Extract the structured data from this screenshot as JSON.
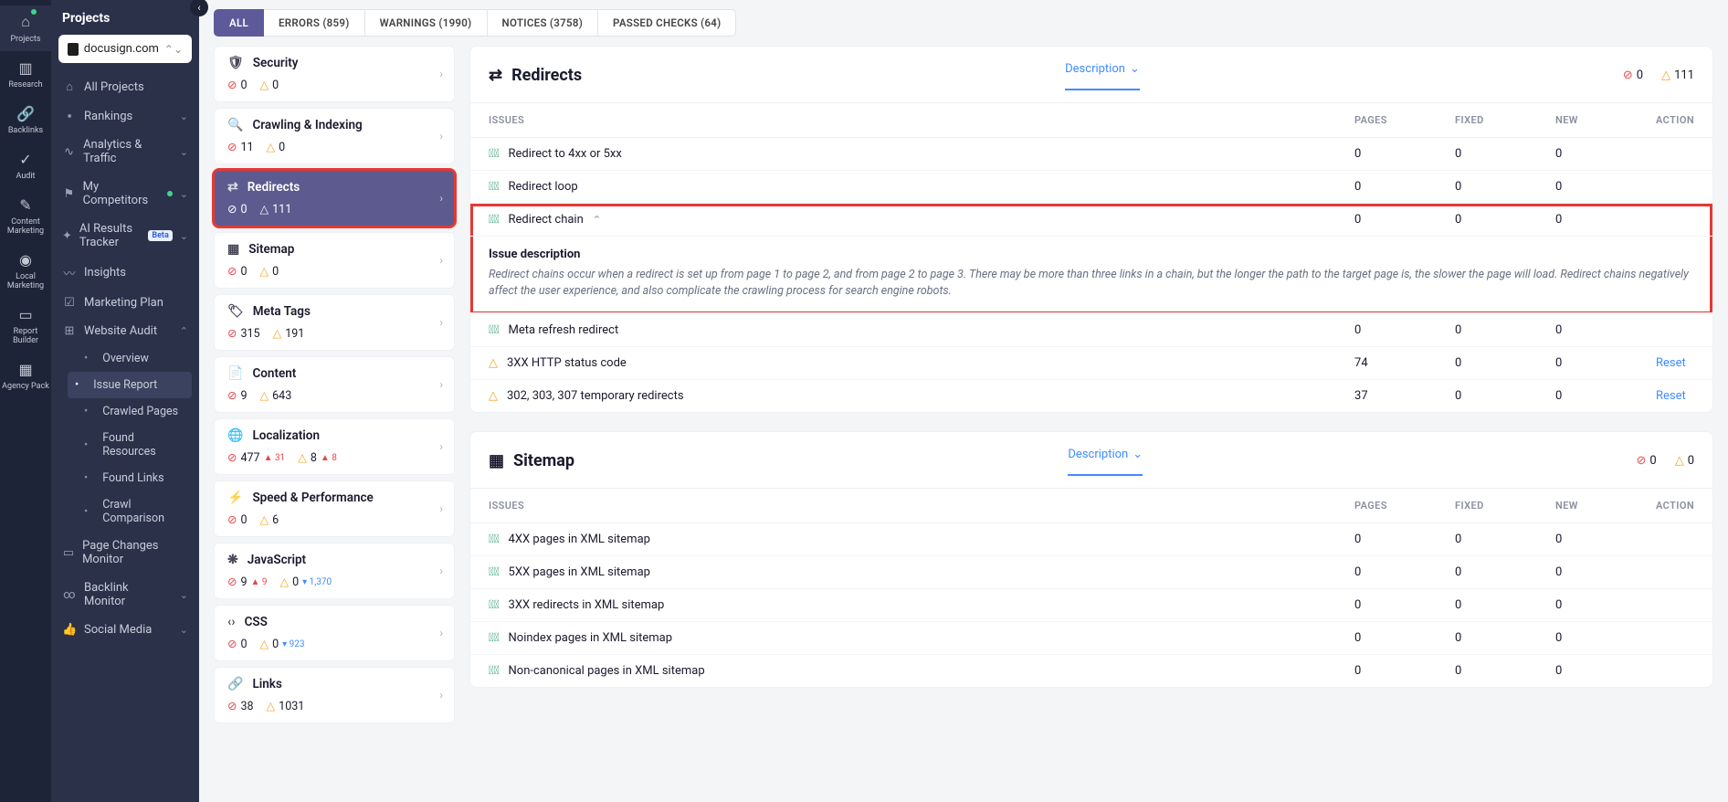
{
  "rail": [
    {
      "label": "Projects",
      "icon": "⌂",
      "active": true,
      "dot": true
    },
    {
      "label": "Research",
      "icon": "▥"
    },
    {
      "label": "Backlinks",
      "icon": "🔗"
    },
    {
      "label": "Audit",
      "icon": "✓"
    },
    {
      "label": "Content Marketing",
      "icon": "✎"
    },
    {
      "label": "Local Marketing",
      "icon": "◉"
    },
    {
      "label": "Report Builder",
      "icon": "▭"
    },
    {
      "label": "Agency Pack",
      "icon": "▦"
    }
  ],
  "sidebar": {
    "title": "Projects",
    "project": "docusign.com",
    "items": [
      {
        "label": "All Projects",
        "icon": "⌂"
      },
      {
        "label": "Rankings",
        "icon": "▪",
        "chev": true
      },
      {
        "label": "Analytics & Traffic",
        "icon": "∿",
        "chev": true
      },
      {
        "label": "My Competitors",
        "icon": "⚑",
        "chev": true,
        "dot": true
      },
      {
        "label": "AI Results Tracker",
        "icon": "✦",
        "chev": true,
        "badge": "Beta"
      },
      {
        "label": "Insights",
        "icon": "〰"
      },
      {
        "label": "Marketing Plan",
        "icon": "☑"
      },
      {
        "label": "Website Audit",
        "icon": "⊞",
        "chev": true,
        "open": true,
        "sub": [
          {
            "label": "Overview"
          },
          {
            "label": "Issue Report",
            "active": true
          },
          {
            "label": "Crawled Pages"
          },
          {
            "label": "Found Resources"
          },
          {
            "label": "Found Links"
          },
          {
            "label": "Crawl Comparison"
          }
        ]
      },
      {
        "label": "Page Changes Monitor",
        "icon": "▭"
      },
      {
        "label": "Backlink Monitor",
        "icon": "∞",
        "chev": true
      },
      {
        "label": "Social Media",
        "icon": "👍",
        "chev": true
      }
    ]
  },
  "tabs": [
    {
      "label": "ALL",
      "active": true
    },
    {
      "label": "ERRORS (859)"
    },
    {
      "label": "WARNINGS (1990)"
    },
    {
      "label": "NOTICES (3758)"
    },
    {
      "label": "PASSED CHECKS (64)"
    }
  ],
  "categories": [
    {
      "name": "Security",
      "icon": "🛡",
      "err": "0",
      "warn": "0"
    },
    {
      "name": "Crawling & Indexing",
      "icon": "🔍",
      "err": "11",
      "warn": "0"
    },
    {
      "name": "Redirects",
      "icon": "⇄",
      "err": "0",
      "warn": "111",
      "active": true,
      "highlighted": true
    },
    {
      "name": "Sitemap",
      "icon": "▦",
      "err": "0",
      "warn": "0"
    },
    {
      "name": "Meta Tags",
      "icon": "🏷",
      "err": "315",
      "warn": "191"
    },
    {
      "name": "Content",
      "icon": "📄",
      "err": "9",
      "warn": "643"
    },
    {
      "name": "Localization",
      "icon": "🌐",
      "err": "477",
      "err_trend": "▲ 31",
      "warn": "8",
      "warn_trend": "▲ 8"
    },
    {
      "name": "Speed & Performance",
      "icon": "⚡",
      "err": "0",
      "warn": "6"
    },
    {
      "name": "JavaScript",
      "icon": "❋",
      "err": "9",
      "err_trend": "▲ 9",
      "warn": "0",
      "warn_trend2": "▾ 1,370"
    },
    {
      "name": "CSS",
      "icon": "‹›",
      "err": "0",
      "warn": "0",
      "warn_trend2": "▾ 923"
    },
    {
      "name": "Links",
      "icon": "🔗",
      "err": "38",
      "warn": "1031"
    }
  ],
  "redirects": {
    "title": "Redirects",
    "desc_label": "Description",
    "col_issues": "ISSUES",
    "col_pages": "PAGES",
    "col_fixed": "FIXED",
    "col_new": "NEW",
    "col_action": "ACTION",
    "total_err": "0",
    "total_warn": "111",
    "rows": [
      {
        "status": "ok",
        "name": "Redirect to 4xx or 5xx",
        "pages": "0",
        "fixed": "0",
        "new": "0"
      },
      {
        "status": "ok",
        "name": "Redirect loop",
        "pages": "0",
        "fixed": "0",
        "new": "0"
      },
      {
        "status": "ok",
        "name": "Redirect chain",
        "pages": "0",
        "fixed": "0",
        "new": "0",
        "expanded": true
      },
      {
        "status": "ok",
        "name": "Meta refresh redirect",
        "pages": "0",
        "fixed": "0",
        "new": "0"
      },
      {
        "status": "warn",
        "name": "3XX HTTP status code",
        "pages": "74",
        "fixed": "0",
        "new": "0",
        "action": "Reset"
      },
      {
        "status": "warn",
        "name": "302, 303, 307 temporary redirects",
        "pages": "37",
        "fixed": "0",
        "new": "0",
        "action": "Reset"
      }
    ],
    "desc_title": "Issue description",
    "desc_body": "Redirect chains occur when a redirect is set up from page 1 to page 2, and from page 2 to page 3. There may be more than three links in a chain, but the longer the path to the target page is, the slower the page will load. Redirect chains negatively affect the user experience, and also complicate the crawling process for search engine robots."
  },
  "sitemap": {
    "title": "Sitemap",
    "desc_label": "Description",
    "total_err": "0",
    "total_warn": "0",
    "rows": [
      {
        "status": "ok",
        "name": "4XX pages in XML sitemap",
        "pages": "0",
        "fixed": "0",
        "new": "0"
      },
      {
        "status": "ok",
        "name": "5XX pages in XML sitemap",
        "pages": "0",
        "fixed": "0",
        "new": "0"
      },
      {
        "status": "ok",
        "name": "3XX redirects in XML sitemap",
        "pages": "0",
        "fixed": "0",
        "new": "0"
      },
      {
        "status": "ok",
        "name": "Noindex pages in XML sitemap",
        "pages": "0",
        "fixed": "0",
        "new": "0"
      },
      {
        "status": "ok",
        "name": "Non-canonical pages in XML sitemap",
        "pages": "0",
        "fixed": "0",
        "new": "0"
      }
    ]
  }
}
